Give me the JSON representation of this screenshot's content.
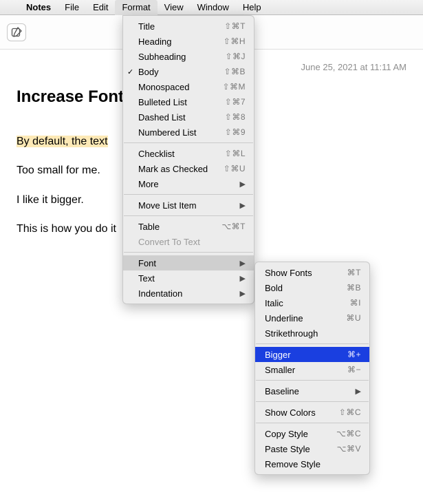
{
  "menubar": {
    "apple": "",
    "app": "Notes",
    "items": [
      "File",
      "Edit",
      "Format",
      "View",
      "Window",
      "Help"
    ],
    "open": "Format"
  },
  "content": {
    "timestamp": "June 25, 2021 at 11:11 AM",
    "title": "Increase Font",
    "title_obscured_tail": "es",
    "lines": {
      "l1_hl": "By default, the text ",
      "l2": "Too small for me.",
      "l3": "I like it bigger.",
      "l4": "This is how you do it"
    }
  },
  "format_menu": {
    "title": {
      "label": "Title",
      "shortcut": "⇧⌘T"
    },
    "heading": {
      "label": "Heading",
      "shortcut": "⇧⌘H"
    },
    "subheading": {
      "label": "Subheading",
      "shortcut": "⇧⌘J"
    },
    "body": {
      "label": "Body",
      "shortcut": "⇧⌘B",
      "checked": true
    },
    "monospaced": {
      "label": "Monospaced",
      "shortcut": "⇧⌘M"
    },
    "bulleted": {
      "label": "Bulleted List",
      "shortcut": "⇧⌘7"
    },
    "dashed": {
      "label": "Dashed List",
      "shortcut": "⇧⌘8"
    },
    "numbered": {
      "label": "Numbered List",
      "shortcut": "⇧⌘9"
    },
    "checklist": {
      "label": "Checklist",
      "shortcut": "⇧⌘L"
    },
    "mark_checked": {
      "label": "Mark as Checked",
      "shortcut": "⇧⌘U"
    },
    "more": {
      "label": "More"
    },
    "move_list": {
      "label": "Move List Item"
    },
    "table": {
      "label": "Table",
      "shortcut": "⌥⌘T"
    },
    "convert": {
      "label": "Convert To Text"
    },
    "font": {
      "label": "Font"
    },
    "text": {
      "label": "Text"
    },
    "indentation": {
      "label": "Indentation"
    }
  },
  "font_menu": {
    "show_fonts": {
      "label": "Show Fonts",
      "shortcut": "⌘T"
    },
    "bold": {
      "label": "Bold",
      "shortcut": "⌘B"
    },
    "italic": {
      "label": "Italic",
      "shortcut": "⌘I"
    },
    "underline": {
      "label": "Underline",
      "shortcut": "⌘U"
    },
    "strike": {
      "label": "Strikethrough"
    },
    "bigger": {
      "label": "Bigger",
      "shortcut": "⌘+"
    },
    "smaller": {
      "label": "Smaller",
      "shortcut": "⌘−"
    },
    "baseline": {
      "label": "Baseline"
    },
    "show_colors": {
      "label": "Show Colors",
      "shortcut": "⇧⌘C"
    },
    "copy_style": {
      "label": "Copy Style",
      "shortcut": "⌥⌘C"
    },
    "paste_style": {
      "label": "Paste Style",
      "shortcut": "⌥⌘V"
    },
    "remove_style": {
      "label": "Remove Style"
    }
  }
}
